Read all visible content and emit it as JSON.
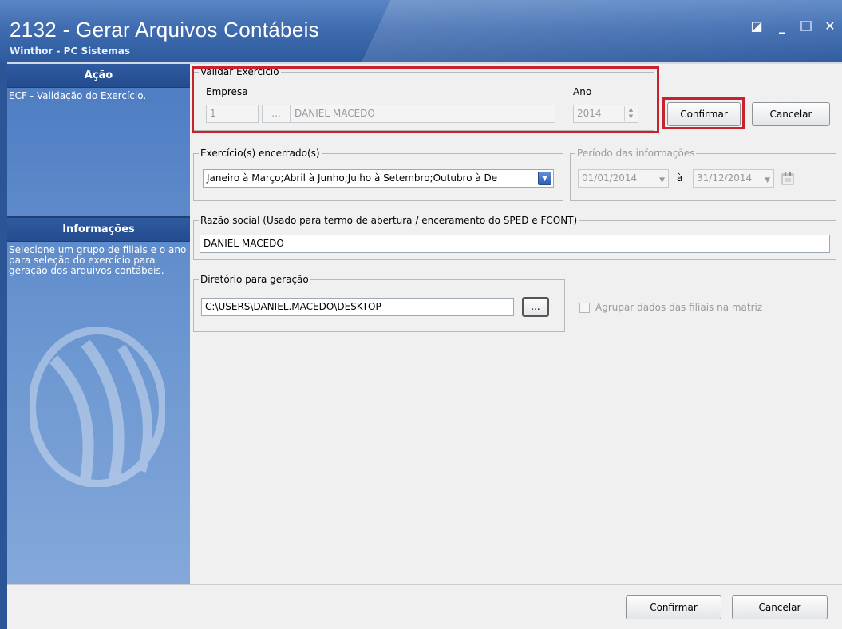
{
  "window": {
    "title": "2132 - Gerar Arquivos Contábeis",
    "subtitle": "Winthor - PC Sistemas"
  },
  "sidebar": {
    "acao_header": "Ação",
    "acao_text": "ECF - Validação do Exercício.",
    "info_header": "Informações",
    "info_text": "Selecione um grupo de filiais e o ano para seleção do exercício para geração dos arquivos contábeis."
  },
  "validar": {
    "legend": "Validar Exercício",
    "empresa_label": "Empresa",
    "empresa_code": "1",
    "browse_label": "...",
    "empresa_name": "DANIEL MACEDO",
    "ano_label": "Ano",
    "ano_value": "2014"
  },
  "buttons": {
    "confirmar_top": "Confirmar",
    "cancelar_top": "Cancelar",
    "confirmar_bottom": "Confirmar",
    "cancelar_bottom": "Cancelar"
  },
  "exercicios": {
    "legend": "Exercício(s) encerrado(s)",
    "value": "Janeiro à Março;Abril à Junho;Julho à Setembro;Outubro à De"
  },
  "periodo": {
    "legend": "Período das informações",
    "start": "01/01/2014",
    "separator": "à",
    "end": "31/12/2014"
  },
  "razao": {
    "legend": "Razão social (Usado para termo de abertura / enceramento do SPED e FCONT)",
    "value": "DANIEL MACEDO"
  },
  "diretorio": {
    "legend": "Diretório para geração",
    "value": "C:\\USERS\\DANIEL.MACEDO\\DESKTOP",
    "browse_label": "..."
  },
  "agrupar": {
    "label": "Agrupar dados das filiais na matriz"
  },
  "colors": {
    "accent_red": "#c8232c",
    "title_blue": "#3f6cb0",
    "sidebar_blue": "#4c7bc2"
  }
}
